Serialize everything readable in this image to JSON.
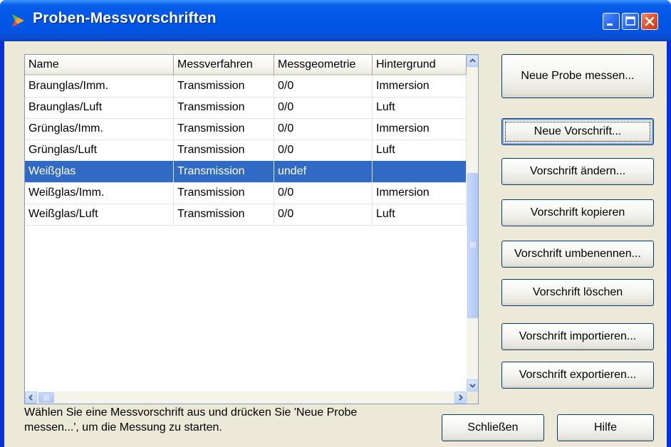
{
  "window": {
    "title": "Proben-Messvorschriften"
  },
  "table": {
    "columns": [
      "Name",
      "Messverfahren",
      "Messgeometrie",
      "Hintergrund"
    ],
    "rows": [
      {
        "name": "Braunglas/Imm.",
        "verfahren": "Transmission",
        "geometrie": "0/0",
        "hintergrund": "Immersion",
        "selected": false
      },
      {
        "name": "Braunglas/Luft",
        "verfahren": "Transmission",
        "geometrie": "0/0",
        "hintergrund": "Luft",
        "selected": false
      },
      {
        "name": "Grünglas/Imm.",
        "verfahren": "Transmission",
        "geometrie": "0/0",
        "hintergrund": "Immersion",
        "selected": false
      },
      {
        "name": "Grünglas/Luft",
        "verfahren": "Transmission",
        "geometrie": "0/0",
        "hintergrund": "Luft",
        "selected": false
      },
      {
        "name": "Weißglas",
        "verfahren": "Transmission",
        "geometrie": "undef",
        "hintergrund": "",
        "selected": true
      },
      {
        "name": "Weißglas/Imm.",
        "verfahren": "Transmission",
        "geometrie": "0/0",
        "hintergrund": "Immersion",
        "selected": false
      },
      {
        "name": "Weißglas/Luft",
        "verfahren": "Transmission",
        "geometrie": "0/0",
        "hintergrund": "Luft",
        "selected": false
      }
    ]
  },
  "buttons": {
    "neue_probe": "Neue Probe messen...",
    "neue_vorschrift": "Neue Vorschrift...",
    "aendern": "Vorschrift ändern...",
    "kopieren": "Vorschrift kopieren",
    "umbenennen": "Vorschrift umbenennen...",
    "loeschen": "Vorschrift löschen",
    "importieren": "Vorschrift importieren...",
    "exportieren": "Vorschrift exportieren...",
    "schliessen": "Schließen",
    "hilfe": "Hilfe"
  },
  "status": {
    "line1": "Wählen Sie eine Messvorschrift aus und drücken Sie 'Neue Probe",
    "line2": "messen...', um die Messung zu starten."
  },
  "colors": {
    "titlebar": "#0054e3",
    "selection": "#316ac5",
    "dialog_bg": "#ece9d8"
  },
  "icons": {
    "app": "app-arrow-icon",
    "minimize": "minimize-icon",
    "maximize": "maximize-icon",
    "close": "close-icon"
  }
}
